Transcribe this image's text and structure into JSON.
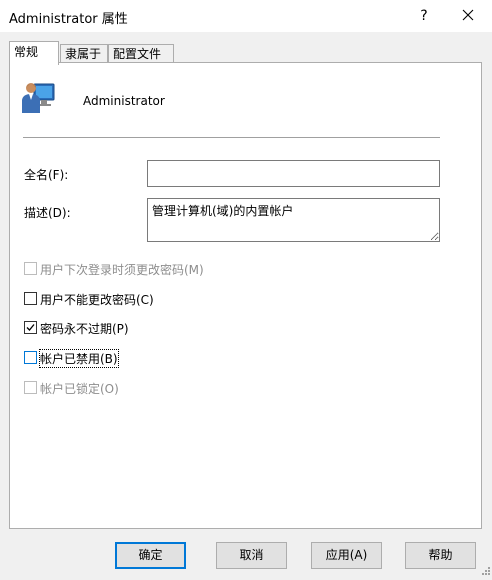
{
  "window": {
    "title": "Administrator 属性",
    "help_glyph": "?",
    "close_icon": "close-icon"
  },
  "tabs": [
    {
      "label": "常规",
      "active": true
    },
    {
      "label": "隶属于",
      "active": false
    },
    {
      "label": "配置文件",
      "active": false
    }
  ],
  "general": {
    "user_icon": "user-account-icon",
    "user_name": "Administrator",
    "fullname_label": "全名(F):",
    "fullname_value": "",
    "desc_label": "描述(D):",
    "desc_value": "管理计算机(域)的内置帐户",
    "checkboxes": [
      {
        "label": "用户下次登录时须更改密码(M)",
        "checked": false,
        "enabled": false
      },
      {
        "label": "用户不能更改密码(C)",
        "checked": false,
        "enabled": true
      },
      {
        "label": "密码永不过期(P)",
        "checked": true,
        "enabled": true
      },
      {
        "label": "帐户已禁用(B)",
        "checked": false,
        "enabled": true
      },
      {
        "label": "帐户已锁定(O)",
        "checked": false,
        "enabled": false
      }
    ]
  },
  "buttons": {
    "ok": "确定",
    "cancel": "取消",
    "apply": "应用(A)",
    "help": "帮助"
  },
  "colors": {
    "accent": "#0078d7",
    "dialog_bg": "#f0f0f0",
    "button_bg": "#e1e1e1"
  }
}
